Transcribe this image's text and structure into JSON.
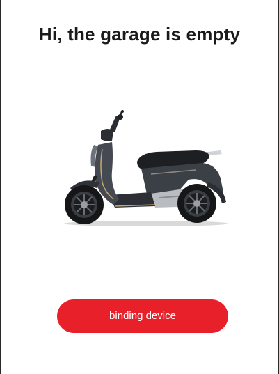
{
  "header": {
    "title": "Hi, the garage is empty"
  },
  "illustration": {
    "icon": "scooter-illustration"
  },
  "actions": {
    "bind_label": "binding device"
  },
  "colors": {
    "accent": "#e8202a",
    "title_text": "#1a1a1a",
    "background": "#ffffff"
  }
}
